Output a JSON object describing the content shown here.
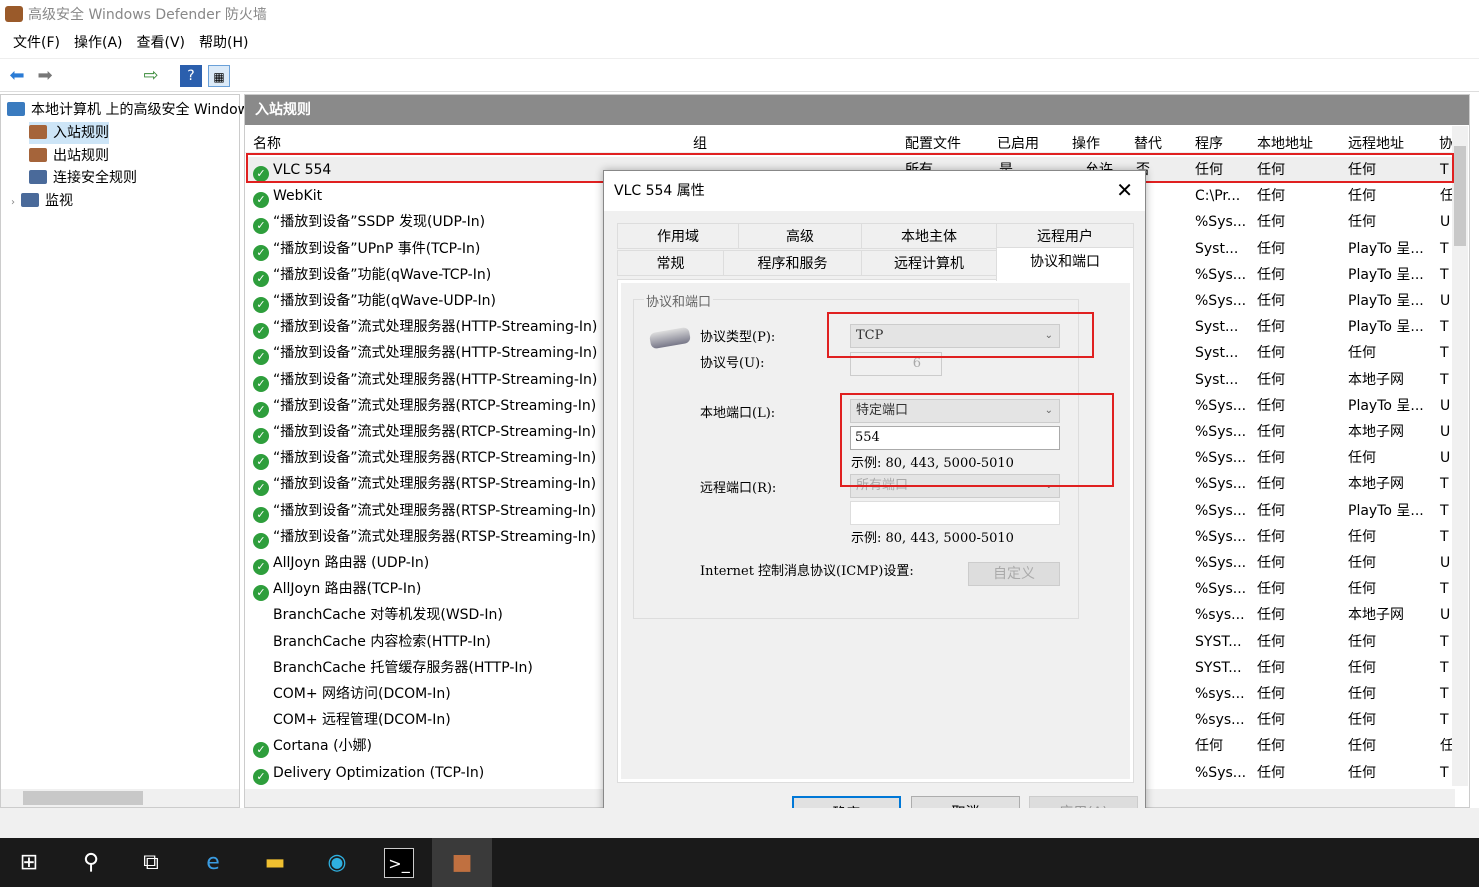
{
  "window": {
    "title": "高级安全 Windows Defender 防火墙"
  },
  "menu": [
    "文件(F)",
    "操作(A)",
    "查看(V)",
    "帮助(H)"
  ],
  "tree": {
    "root": "本地计算机 上的高级安全 Windows",
    "items": [
      "入站规则",
      "出站规则",
      "连接安全规则",
      "监视"
    ]
  },
  "main": {
    "header": "入站规则",
    "columns": [
      "名称",
      "组",
      "配置文件",
      "已启用",
      "操作",
      "替代",
      "程序",
      "本地地址",
      "远程地址",
      "协"
    ],
    "rows": [
      {
        "name": "VLC 554",
        "profile": "所有",
        "enabled": "是",
        "action": "允许",
        "override": "否",
        "program": "任何",
        "local": "任何",
        "remote": "任何",
        "proto": "T",
        "on": true
      },
      {
        "name": "WebKit",
        "program": "C:\\Pr...",
        "local": "任何",
        "remote": "任何",
        "proto": "任",
        "on": true
      },
      {
        "name": "“播放到设备”SSDP 发现(UDP-In)",
        "program": "%Sys...",
        "local": "任何",
        "remote": "任何",
        "proto": "U",
        "on": true
      },
      {
        "name": "“播放到设备”UPnP 事件(TCP-In)",
        "program": "Syst...",
        "local": "任何",
        "remote": "PlayTo 呈...",
        "proto": "T",
        "on": true
      },
      {
        "name": "“播放到设备”功能(qWave-TCP-In)",
        "program": "%Sys...",
        "local": "任何",
        "remote": "PlayTo 呈...",
        "proto": "T",
        "on": true
      },
      {
        "name": "“播放到设备”功能(qWave-UDP-In)",
        "program": "%Sys...",
        "local": "任何",
        "remote": "PlayTo 呈...",
        "proto": "U",
        "on": true
      },
      {
        "name": "“播放到设备”流式处理服务器(HTTP-Streaming-In)",
        "program": "Syst...",
        "local": "任何",
        "remote": "PlayTo 呈...",
        "proto": "T",
        "on": true
      },
      {
        "name": "“播放到设备”流式处理服务器(HTTP-Streaming-In)",
        "program": "Syst...",
        "local": "任何",
        "remote": "任何",
        "proto": "T",
        "on": true
      },
      {
        "name": "“播放到设备”流式处理服务器(HTTP-Streaming-In)",
        "program": "Syst...",
        "local": "任何",
        "remote": "本地子网",
        "proto": "T",
        "on": true
      },
      {
        "name": "“播放到设备”流式处理服务器(RTCP-Streaming-In)",
        "program": "%Sys...",
        "local": "任何",
        "remote": "PlayTo 呈...",
        "proto": "U",
        "on": true
      },
      {
        "name": "“播放到设备”流式处理服务器(RTCP-Streaming-In)",
        "program": "%Sys...",
        "local": "任何",
        "remote": "本地子网",
        "proto": "U",
        "on": true
      },
      {
        "name": "“播放到设备”流式处理服务器(RTCP-Streaming-In)",
        "program": "%Sys...",
        "local": "任何",
        "remote": "任何",
        "proto": "U",
        "on": true
      },
      {
        "name": "“播放到设备”流式处理服务器(RTSP-Streaming-In)",
        "program": "%Sys...",
        "local": "任何",
        "remote": "本地子网",
        "proto": "T",
        "on": true
      },
      {
        "name": "“播放到设备”流式处理服务器(RTSP-Streaming-In)",
        "program": "%Sys...",
        "local": "任何",
        "remote": "PlayTo 呈...",
        "proto": "T",
        "on": true
      },
      {
        "name": "“播放到设备”流式处理服务器(RTSP-Streaming-In)",
        "program": "%Sys...",
        "local": "任何",
        "remote": "任何",
        "proto": "T",
        "on": true
      },
      {
        "name": "AllJoyn 路由器 (UDP-In)",
        "program": "%Sys...",
        "local": "任何",
        "remote": "任何",
        "proto": "U",
        "on": true
      },
      {
        "name": "AllJoyn 路由器(TCP-In)",
        "program": "%Sys...",
        "local": "任何",
        "remote": "任何",
        "proto": "T",
        "on": true
      },
      {
        "name": "BranchCache 对等机发现(WSD-In)",
        "program": "%sys...",
        "local": "任何",
        "remote": "本地子网",
        "proto": "U",
        "on": false
      },
      {
        "name": "BranchCache 内容检索(HTTP-In)",
        "program": "SYST...",
        "local": "任何",
        "remote": "任何",
        "proto": "T",
        "on": false
      },
      {
        "name": "BranchCache 托管缓存服务器(HTTP-In)",
        "program": "SYST...",
        "local": "任何",
        "remote": "任何",
        "proto": "T",
        "on": false
      },
      {
        "name": "COM+ 网络访问(DCOM-In)",
        "program": "%sys...",
        "local": "任何",
        "remote": "任何",
        "proto": "T",
        "on": false
      },
      {
        "name": "COM+ 远程管理(DCOM-In)",
        "program": "%sys...",
        "local": "任何",
        "remote": "任何",
        "proto": "T",
        "on": false
      },
      {
        "name": "Cortana (小娜)",
        "program": "任何",
        "local": "任何",
        "remote": "任何",
        "proto": "任",
        "on": true
      },
      {
        "name": "Delivery Optimization (TCP-In)",
        "program": "%Sys...",
        "local": "任何",
        "remote": "任何",
        "proto": "T",
        "on": true
      }
    ]
  },
  "dialog": {
    "title": "VLC 554 属性",
    "tabs_top": [
      "作用域",
      "高级",
      "本地主体",
      "远程用户"
    ],
    "tabs_bottom": [
      "常规",
      "程序和服务",
      "远程计算机",
      "协议和端口"
    ],
    "group": "协议和端口",
    "protocol_type_label": "协议类型(P):",
    "protocol_type": "TCP",
    "protocol_number_label": "协议号(U):",
    "protocol_number": "6",
    "local_port_label": "本地端口(L):",
    "local_port_mode": "特定端口",
    "local_port": "554",
    "example": "示例: 80, 443, 5000-5010",
    "remote_port_label": "远程端口(R):",
    "remote_port_mode": "所有端口",
    "remote_port": "",
    "icmp_label": "Internet 控制消息协议(ICMP)设置:",
    "customize": "自定义",
    "ok": "确定",
    "cancel": "取消",
    "apply": "应用(A)"
  }
}
